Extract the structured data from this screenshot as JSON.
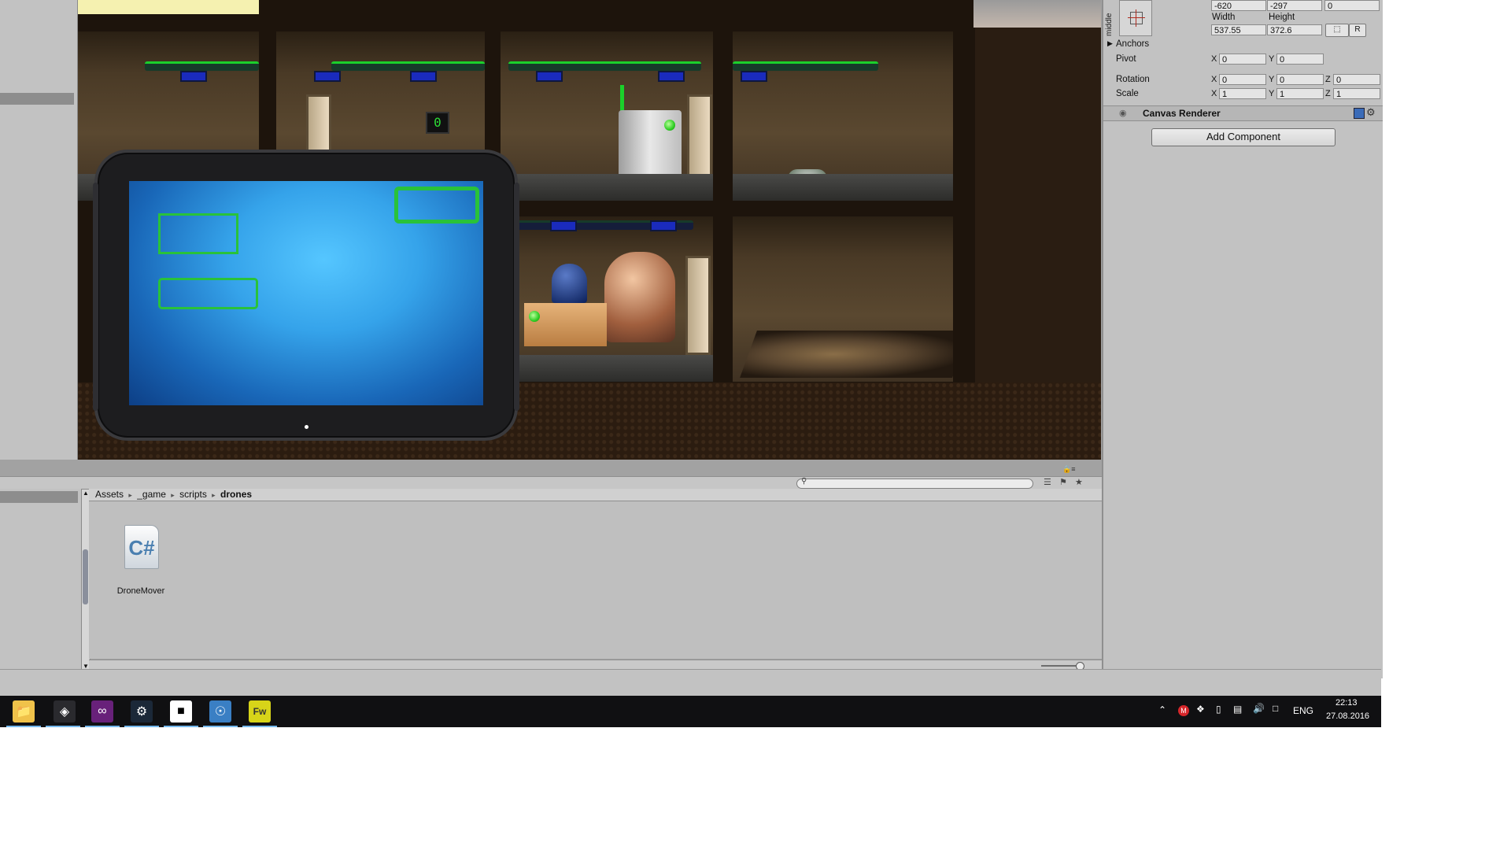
{
  "inspector": {
    "pos_x": "-620",
    "pos_y": "-297",
    "pos_z": "0",
    "width_label": "Width",
    "height_label": "Height",
    "width_value": "537.55",
    "height_value": "372.6",
    "anchor_mode_label": "middle",
    "anchors_label": "Anchors",
    "pivot_label": "Pivot",
    "pivot_x": "0",
    "pivot_y": "0",
    "rotation_label": "Rotation",
    "rotation_x": "0",
    "rotation_y": "0",
    "rotation_z": "0",
    "scale_label": "Scale",
    "scale_x": "1",
    "scale_y": "1",
    "scale_z": "1",
    "axis_x": "X",
    "axis_y": "Y",
    "axis_z": "Z",
    "raw_button": "R",
    "component_title": "Canvas Renderer",
    "add_component_label": "Add Component"
  },
  "scene": {
    "digit_display": "0"
  },
  "project": {
    "breadcrumb": [
      "Assets",
      "_game",
      "scripts",
      "drones"
    ],
    "breadcrumb_separator": "▸",
    "file_name": "DroneMover",
    "file_icon_text": "C#"
  },
  "taskbar": {
    "language": "ENG",
    "time": "22:13",
    "date": "27.08.2016"
  },
  "colors": {
    "tablet_outline_green": "#29c23a",
    "pipe_green": "#1bd02b",
    "taskbar_bg": "#101012"
  }
}
